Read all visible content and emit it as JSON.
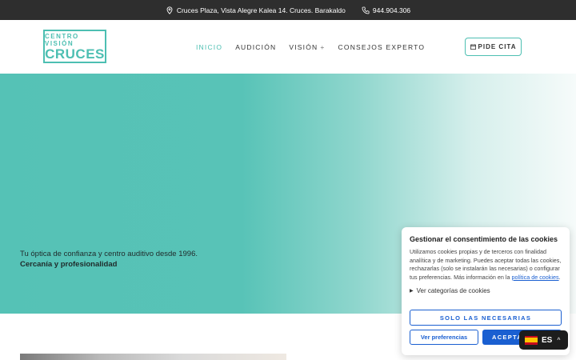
{
  "topbar": {
    "address": "Cruces Plaza, Vista Alegre Kalea 14. Cruces. Barakaldo",
    "address_icon": "map-pin-icon",
    "phone": "944.904.306",
    "phone_icon": "phone-icon"
  },
  "header": {
    "logo_line1": "CENTRO VISIÓN",
    "logo_line2": "CRUCES",
    "nav": [
      {
        "label": "INICIO",
        "active": true
      },
      {
        "label": "AUDICIÓN",
        "active": false
      },
      {
        "label": "VISIÓN",
        "active": false,
        "expand": "+"
      },
      {
        "label": "CONSEJOS EXPERTO",
        "active": false
      }
    ],
    "cta_label": "PIDE CITA",
    "cta_icon": "calendar-icon"
  },
  "hero": {
    "tagline": "Tu óptica de confianza y centro auditivo desde 1996.",
    "tagline_bold": "Cercanía y profesionalidad"
  },
  "cookie_banner": {
    "title": "Gestionar el consentimiento de las cookies",
    "body": "Utilizamos cookies propias y de terceros con finalidad analítica y de marketing. Puedes aceptar todas las cookies, rechazarlas (solo se instalarán las necesarias) o configurar tus preferencias. Más información en la ",
    "policy_link": "política de cookies",
    "body_end": ".",
    "categories_toggle": "Ver categorías de cookies",
    "btn_necessary": "SOLO LAS NECESARIAS",
    "btn_preferences": "Ver preferencias",
    "btn_accept": "ACEPTAR"
  },
  "language_switcher": {
    "code": "ES",
    "flag_icon": "spain-flag-icon",
    "caret_icon": "chevron-up-icon"
  },
  "colors": {
    "brand_teal": "#4dbfb2",
    "topbar_bg": "#2e2e2e",
    "cookie_blue": "#1a5fd1"
  }
}
